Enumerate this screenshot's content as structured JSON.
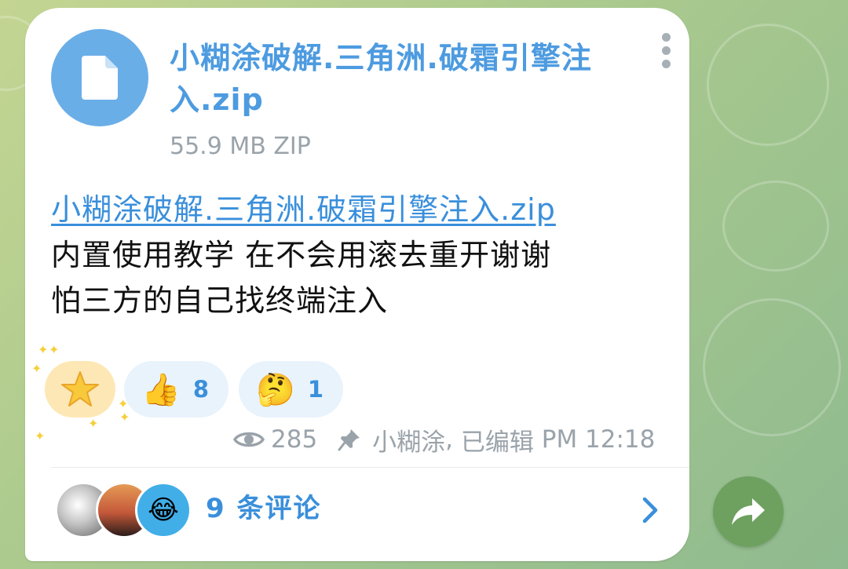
{
  "file": {
    "name": "小糊涂破解.三角洲.破霜引擎注入.zip",
    "meta": "55.9 MB ZIP",
    "icon": "document-icon"
  },
  "message": {
    "link_text": "小糊涂破解.三角洲.破霜引擎注入.zip",
    "line2": "内置使用教学 在不会用滚去重开谢谢",
    "line3": "怕三方的自己找终端注入"
  },
  "reactions": [
    {
      "emoji": "⭐",
      "count": "",
      "name": "star"
    },
    {
      "emoji": "👍",
      "count": "8",
      "name": "thumbs-up"
    },
    {
      "emoji": "🤔",
      "count": "1",
      "name": "thinking-face"
    }
  ],
  "stats": {
    "views": "285",
    "author": "小糊涂",
    "edited_label": "已编辑",
    "time": "PM 12:18"
  },
  "comments": {
    "label": "9 条评论"
  },
  "colors": {
    "accent": "#3a8fdb",
    "file_icon_bg": "#6aaee8",
    "share_button": "#6ea160",
    "meta_gray": "#9aa3aa",
    "background_green": "#a9c98e"
  }
}
